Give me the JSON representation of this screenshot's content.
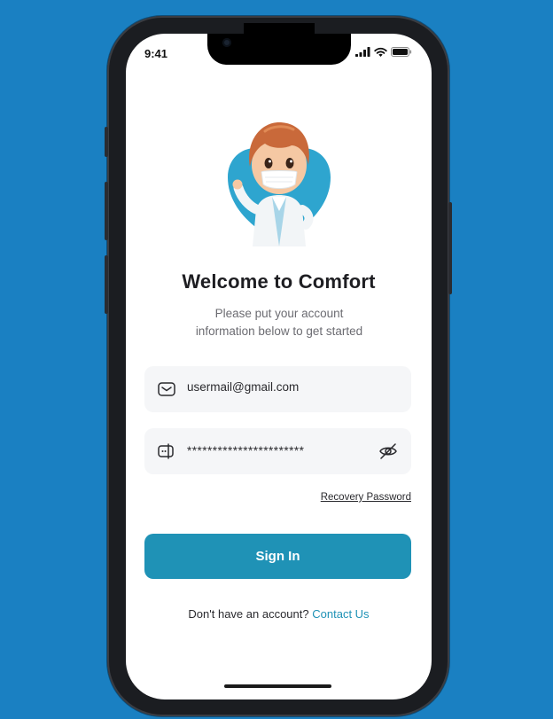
{
  "status_bar": {
    "time": "9:41"
  },
  "welcome": {
    "title": "Welcome to Comfort",
    "subtitle_line1": "Please put your account",
    "subtitle_line2": "information below to get started"
  },
  "form": {
    "email_value": "usermail@gmail.com",
    "password_value": "***********************",
    "recovery_label": "Recovery Password",
    "signin_label": "Sign In"
  },
  "footer": {
    "prompt": "Don't have an account?",
    "link": "Contact Us"
  },
  "icons": {
    "email": "envelope-icon",
    "password": "password-icon",
    "eye": "eye-off-icon"
  },
  "colors": {
    "background": "#1a80c2",
    "accent": "#1f92b6",
    "field_bg": "#f5f6f8"
  }
}
